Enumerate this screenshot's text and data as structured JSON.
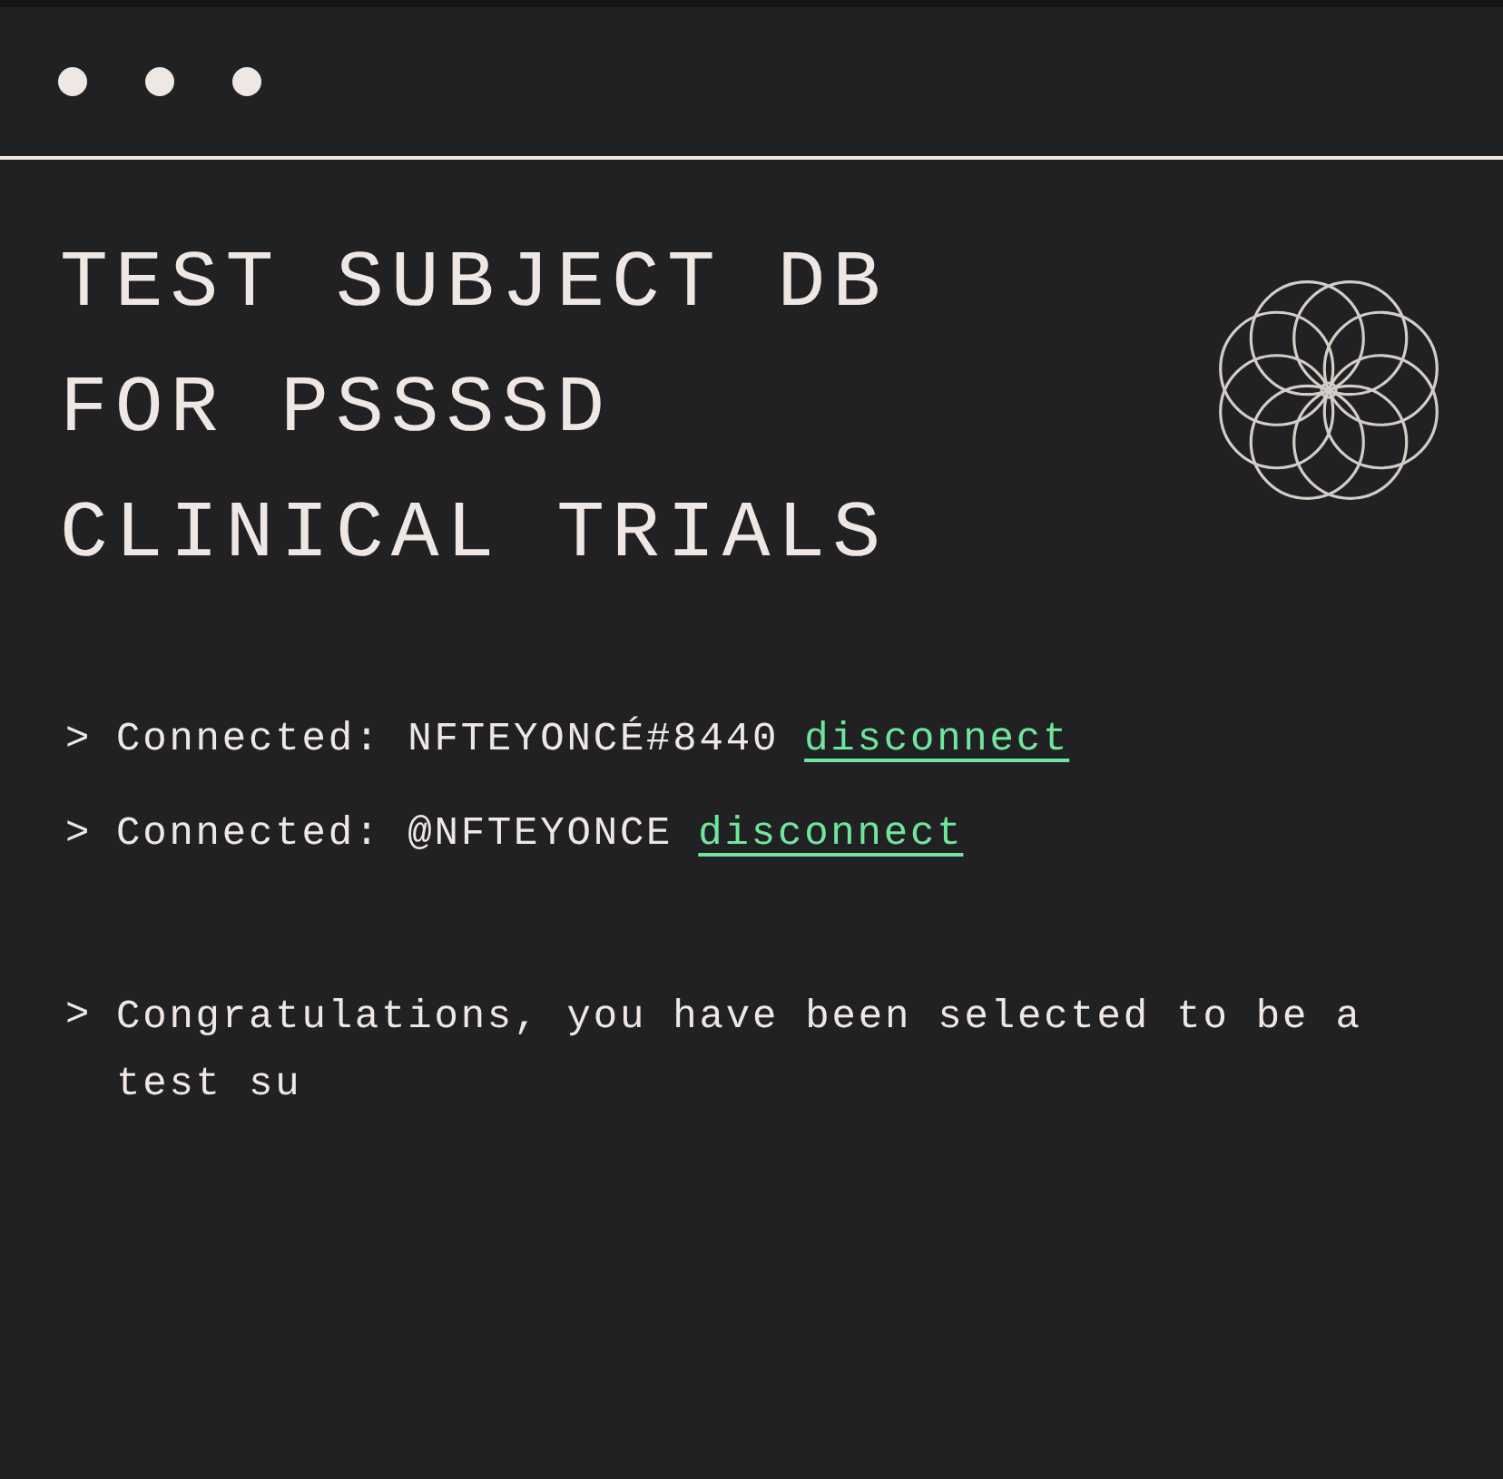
{
  "title_lines": [
    "TEST SUBJECT DB",
    "FOR PSSSSD",
    "CLINICAL TRIALS"
  ],
  "console": [
    {
      "kind": "connection",
      "prompt": ">",
      "text": "Connected: NFTEYONCÉ#8440",
      "link": "disconnect"
    },
    {
      "kind": "connection",
      "prompt": ">",
      "text": "Connected: @NFTEYONCE",
      "link": "disconnect"
    },
    {
      "kind": "message",
      "prompt": ">",
      "text": "Congratulations, you have been selected to be a test su"
    }
  ]
}
